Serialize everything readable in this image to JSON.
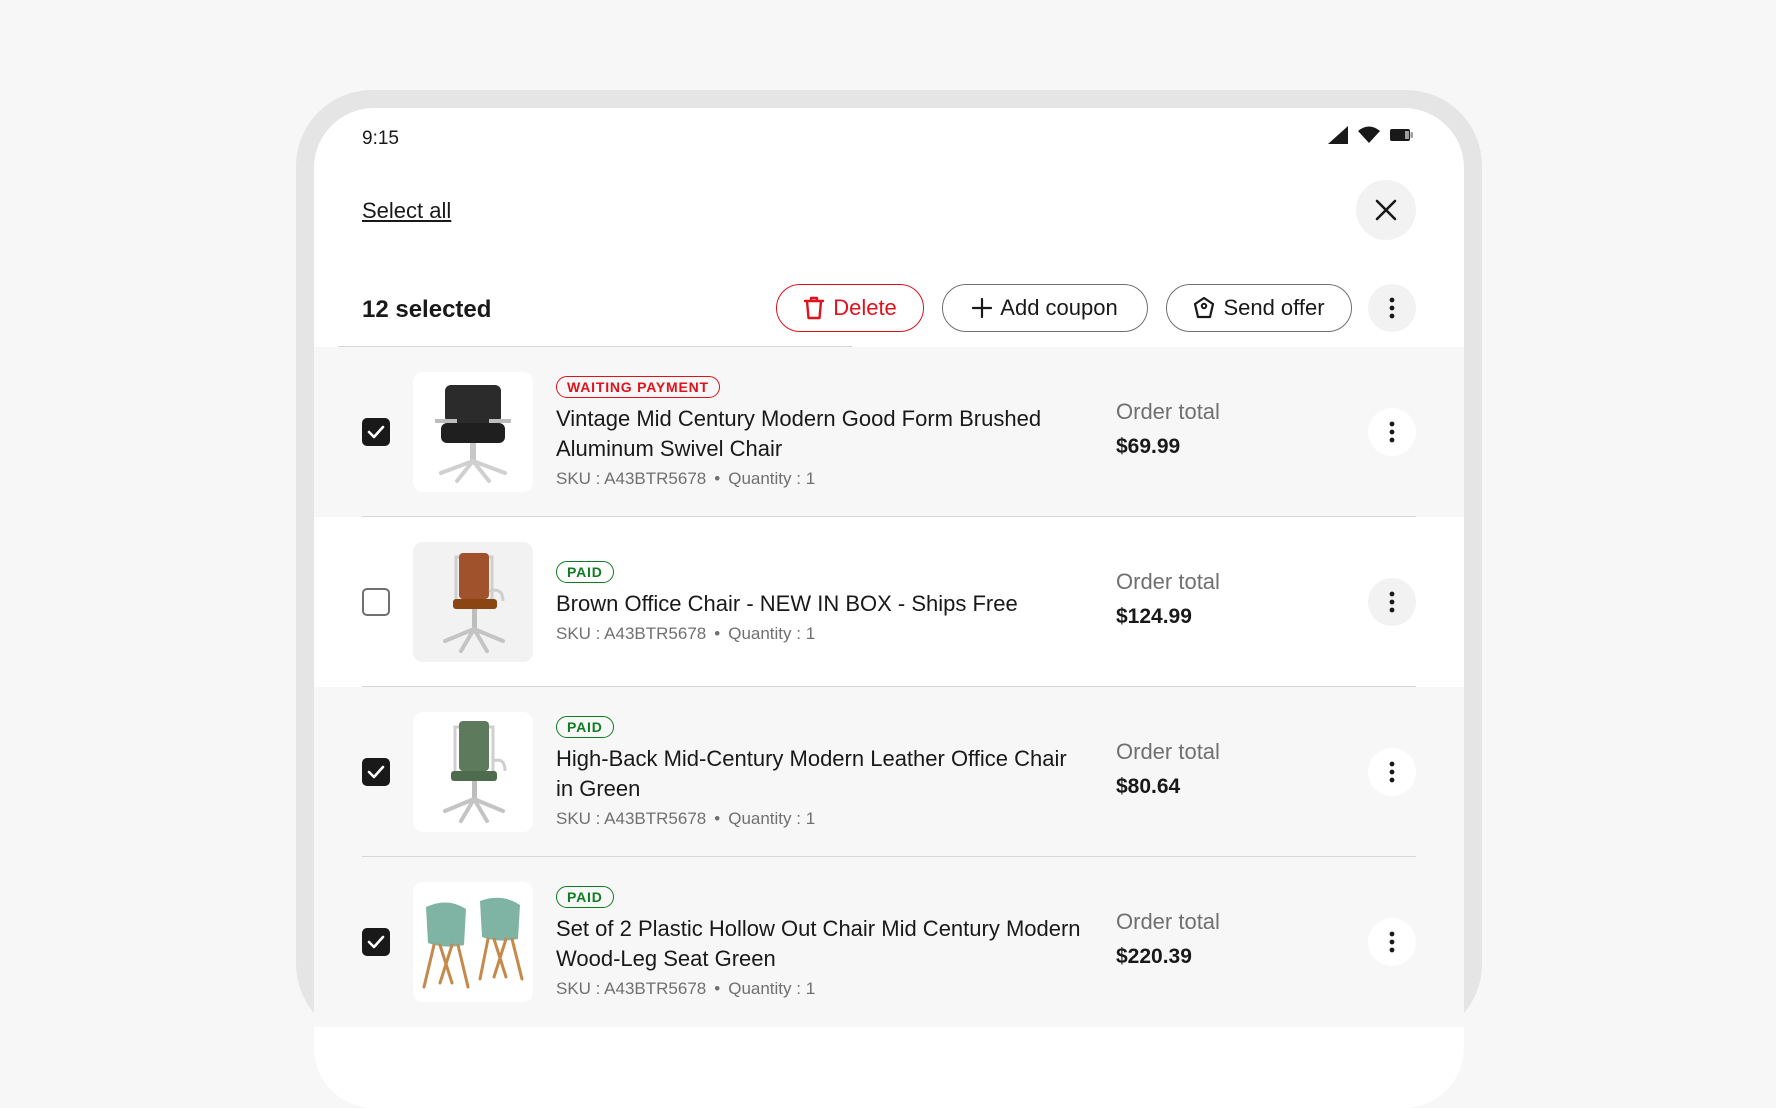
{
  "status": {
    "time": "9:15"
  },
  "header": {
    "select_all": "Select all"
  },
  "toolbar": {
    "selected_count": "12 selected",
    "delete_label": "Delete",
    "add_coupon_label": "Add coupon",
    "send_offer_label": "Send offer"
  },
  "colors": {
    "danger": "#e0121b",
    "success": "#0e7c22",
    "text": "#191919",
    "muted": "#707070"
  },
  "orders": [
    {
      "selected": true,
      "badge": "WAITING PAYMENT",
      "badge_color": "red",
      "title": "Vintage Mid Century Modern Good Form Brushed Aluminum Swivel Chair",
      "sku": "SKU : A43BTR5678",
      "quantity": "Quantity : 1",
      "total_label": "Order total",
      "total": "$69.99",
      "image_icon": "black-office-chair-icon"
    },
    {
      "selected": false,
      "badge": "PAID",
      "badge_color": "green",
      "title": "Brown Office Chair - NEW IN BOX - Ships Free",
      "sku": "SKU : A43BTR5678",
      "quantity": "Quantity : 1",
      "total_label": "Order total",
      "total": "$124.99",
      "image_icon": "brown-office-chair-icon"
    },
    {
      "selected": true,
      "badge": "PAID",
      "badge_color": "green",
      "title": "High-Back Mid-Century Modern Leather Office Chair in Green",
      "sku": "SKU : A43BTR5678",
      "quantity": "Quantity : 1",
      "total_label": "Order total",
      "total": "$80.64",
      "image_icon": "green-office-chair-icon"
    },
    {
      "selected": true,
      "badge": "PAID",
      "badge_color": "green",
      "title": "Set of 2 Plastic Hollow Out Chair Mid Century Modern Wood-Leg Seat Green",
      "sku": "SKU : A43BTR5678",
      "quantity": "Quantity : 1",
      "total_label": "Order total",
      "total": "$220.39",
      "image_icon": "green-plastic-chairs-icon"
    }
  ]
}
